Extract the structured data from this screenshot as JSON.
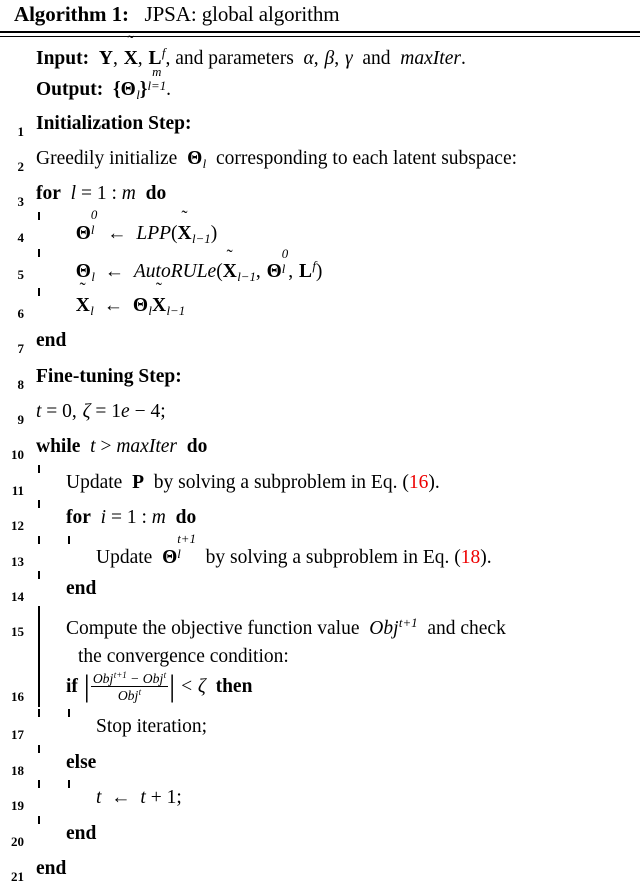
{
  "algorithm": {
    "label": "Algorithm 1:",
    "caption": "JPSA: global algorithm",
    "io": {
      "input_label": "Input:",
      "input_text": "Y, X̃, L^f, and parameters α, β, γ and maxIter.",
      "output_label": "Output:",
      "output_text": "{Θ_l}_{l=1}^{m}."
    },
    "lines": [
      {
        "n": "1",
        "indent": 0,
        "text": "Initialization Step:"
      },
      {
        "n": "2",
        "indent": 0,
        "text": "Greedily initialize Θ_l corresponding to each latent subspace:"
      },
      {
        "n": "3",
        "indent": 0,
        "text": "for l = 1 : m do"
      },
      {
        "n": "4",
        "indent": 1,
        "text": "Θ_l^0 ← LPP(X̃_{l−1})"
      },
      {
        "n": "5",
        "indent": 1,
        "text": "Θ_l ← AutoRULe(X̃_{l−1}, Θ_l^0, L^f)"
      },
      {
        "n": "6",
        "indent": 1,
        "text": "X̃_l ← Θ_l X̃_{l−1}"
      },
      {
        "n": "7",
        "indent": 0,
        "text": "end"
      },
      {
        "n": "8",
        "indent": 0,
        "text": "Fine-tuning Step:"
      },
      {
        "n": "9",
        "indent": 0,
        "text": "t = 0, ζ = 1e − 4;"
      },
      {
        "n": "10",
        "indent": 0,
        "text": "while t > maxIter do"
      },
      {
        "n": "11",
        "indent": 1,
        "text": "Update P by solving a subproblem in Eq. (16)."
      },
      {
        "n": "12",
        "indent": 1,
        "text": "for i = 1 : m do"
      },
      {
        "n": "13",
        "indent": 2,
        "text": "Update Θ_l^{t+1} by solving a subproblem in Eq. (18)."
      },
      {
        "n": "14",
        "indent": 1,
        "text": "end"
      },
      {
        "n": "15",
        "indent": 1,
        "text": "Compute the objective function value Obj^{t+1} and check the convergence condition:"
      },
      {
        "n": "16",
        "indent": 1,
        "text": "if |(Obj^{t+1} − Obj^t)/Obj^t| < ζ then"
      },
      {
        "n": "17",
        "indent": 2,
        "text": "Stop iteration;"
      },
      {
        "n": "18",
        "indent": 1,
        "text": "else"
      },
      {
        "n": "19",
        "indent": 2,
        "text": "t ← t + 1;"
      },
      {
        "n": "20",
        "indent": 1,
        "text": "end"
      },
      {
        "n": "21",
        "indent": 0,
        "text": "end"
      }
    ],
    "eq_refs": {
      "first": "16",
      "second": "18"
    },
    "keywords": {
      "for": "for",
      "do": "do",
      "end": "end",
      "while": "while",
      "if": "if",
      "then": "then",
      "else": "else"
    },
    "colors": {
      "eq_ref": "#ee0000",
      "text": "#000000",
      "rule": "#000000"
    }
  }
}
